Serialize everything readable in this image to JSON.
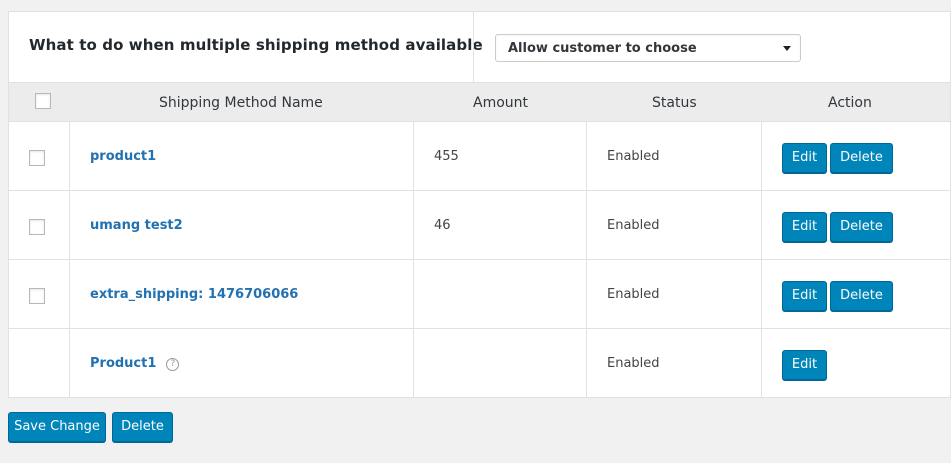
{
  "settings": {
    "label": "What to do when multiple shipping method available",
    "select_value": "Allow customer to choose"
  },
  "table": {
    "headers": {
      "name": "Shipping Method Name",
      "amount": "Amount",
      "status": "Status",
      "action": "Action"
    },
    "rows": [
      {
        "name": "product1",
        "amount": "455",
        "status": "Enabled",
        "edit": "Edit",
        "delete": "Delete"
      },
      {
        "name": "umang test2",
        "amount": "46",
        "status": "Enabled",
        "edit": "Edit",
        "delete": "Delete"
      },
      {
        "name": "extra_shipping: 1476706066",
        "amount": "",
        "status": "Enabled",
        "edit": "Edit",
        "delete": "Delete"
      },
      {
        "name": "Product1",
        "amount": "",
        "status": "Enabled",
        "edit": "Edit",
        "help": "?"
      }
    ]
  },
  "footer": {
    "save_label": "Save Change",
    "delete_label": "Delete"
  },
  "colors": {
    "primary_button": "#0085ba",
    "link": "#2271b1"
  }
}
